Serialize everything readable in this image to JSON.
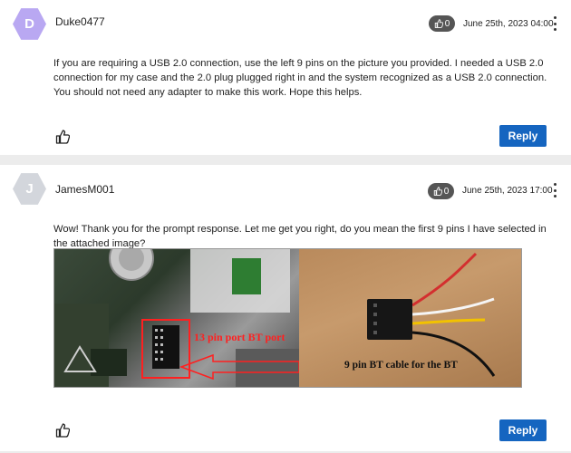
{
  "posts": [
    {
      "avatar_letter": "D",
      "avatar_color": "#b9a8f2",
      "username": "Duke0477",
      "likes": "0",
      "date": "June 25th, 2023 04:00",
      "body": "If you are requiring a USB 2.0 connection, use the left 9 pins on the picture you provided. I needed a USB 2.0 connection for my case and the 2.0 plug plugged right in and the system recognized as a USB 2.0 connection. You should not need any adapter to make this work. Hope this helps.",
      "reply_label": "Reply"
    },
    {
      "avatar_letter": "J",
      "avatar_color": "#d3d6dc",
      "username": "JamesM001",
      "likes": "0",
      "date": "June 25th, 2023 17:00",
      "body": "Wow! Thank you for the prompt response. Let me get you right, do you mean the first 9 pins I have selected in the attached image?",
      "image_label_13pin": "13 pin port BT port",
      "image_label_9pin": "9 pin BT cable for the BT",
      "reply_label": "Reply"
    }
  ],
  "colors": {
    "accent": "#1565c0",
    "badge": "#555555"
  }
}
